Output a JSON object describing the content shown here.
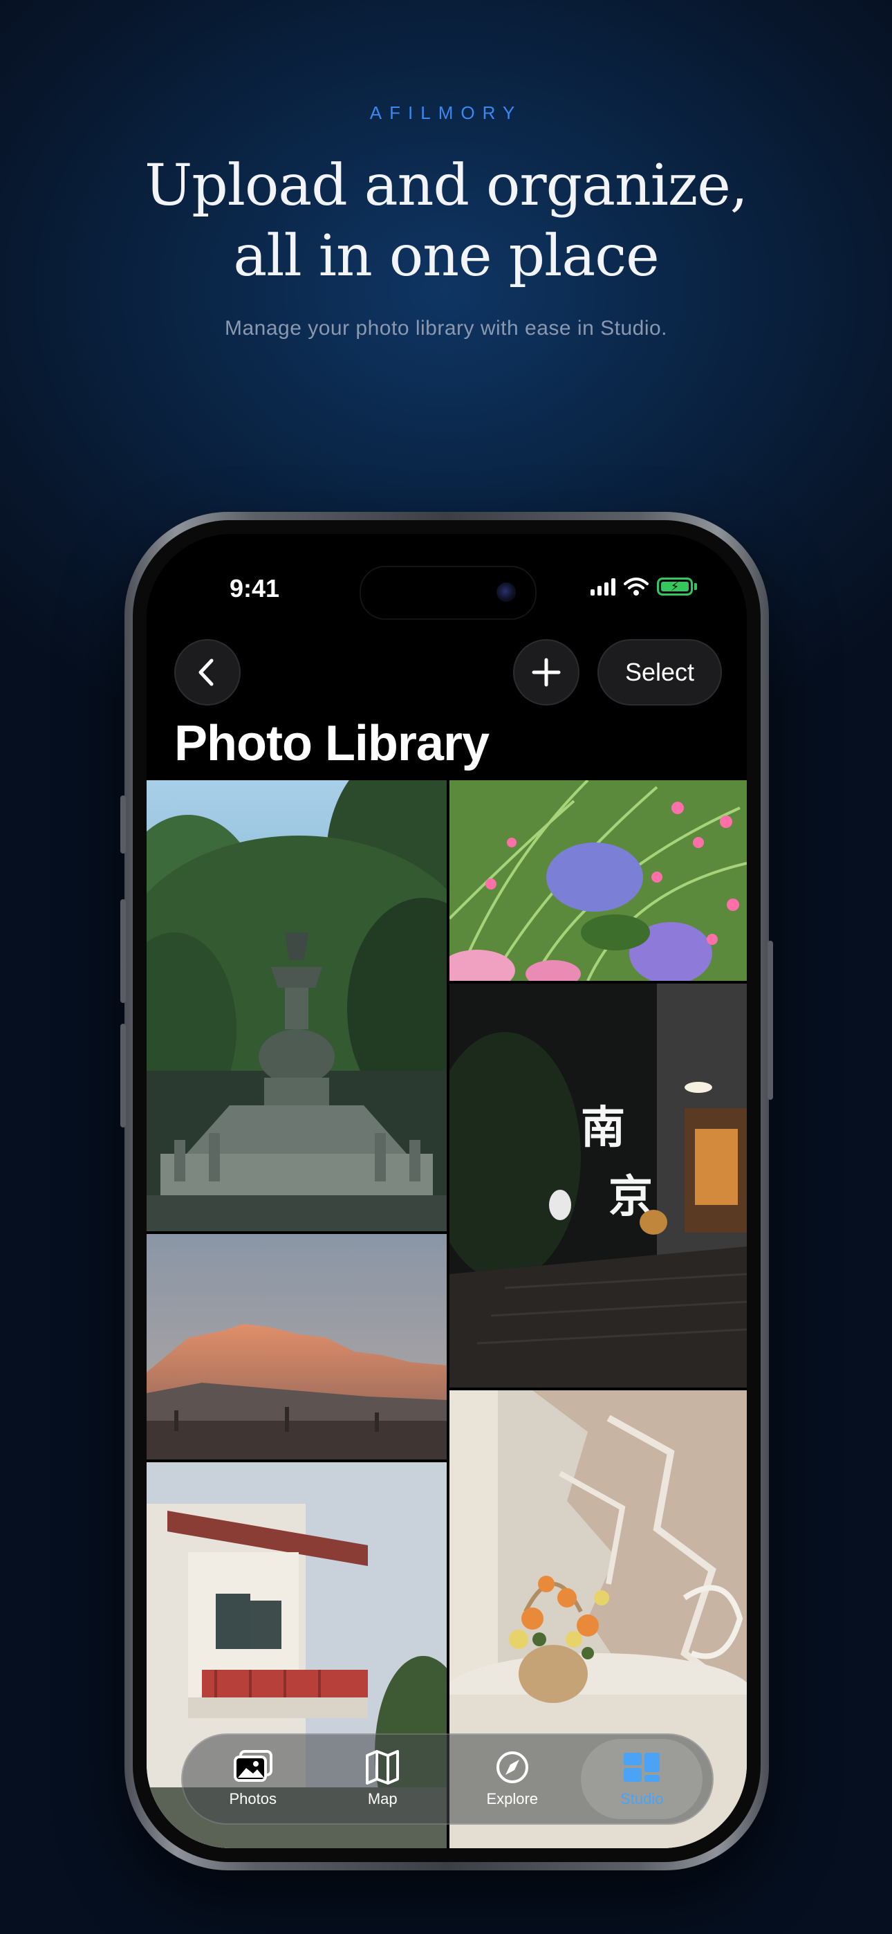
{
  "hero": {
    "eyebrow": "AFILMORY",
    "headline_line1": "Upload and organize,",
    "headline_line2": "all in one place",
    "subhead": "Manage your photo library with ease in Studio."
  },
  "status_bar": {
    "time": "9:41",
    "battery_color": "#35c759"
  },
  "nav": {
    "back_icon": "chevron-left-icon",
    "add_icon": "plus-icon",
    "select_label": "Select"
  },
  "page": {
    "title": "Photo Library"
  },
  "photos": [
    {
      "id": "pagoda",
      "depicts": "stone-pagoda-photo"
    },
    {
      "id": "flowers",
      "depicts": "hydrangea-flowers-photo"
    },
    {
      "id": "nanjing-sign",
      "depicts": "night-street-sign-photo"
    },
    {
      "id": "mountain",
      "depicts": "sunset-mountain-photo"
    },
    {
      "id": "building",
      "depicts": "building-balcony-photo"
    },
    {
      "id": "flower-basket",
      "depicts": "flower-basket-photo"
    }
  ],
  "tabbar": {
    "tabs": [
      {
        "label": "Photos",
        "icon": "photos-icon",
        "active": false
      },
      {
        "label": "Map",
        "icon": "map-icon",
        "active": false
      },
      {
        "label": "Explore",
        "icon": "compass-icon",
        "active": false
      },
      {
        "label": "Studio",
        "icon": "studio-icon",
        "active": true
      }
    ],
    "accent": "#4aa3f5"
  }
}
